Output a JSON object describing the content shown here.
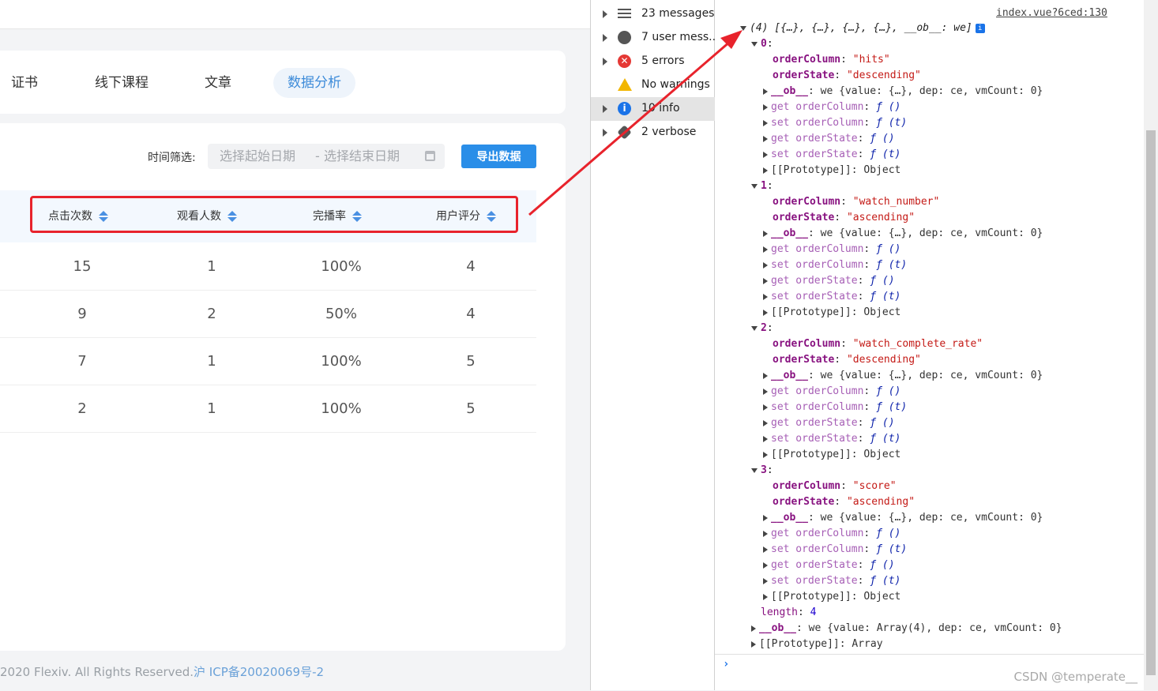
{
  "app": {
    "tabs": [
      {
        "label": "证书",
        "active": false
      },
      {
        "label": "线下课程",
        "active": false
      },
      {
        "label": "文章",
        "active": false
      },
      {
        "label": "数据分析",
        "active": true
      }
    ],
    "filter_label": "时间筛选:",
    "date_start_placeholder": "选择起始日期",
    "date_separator": "-",
    "date_end_placeholder": "选择结束日期",
    "export_label": "导出数据",
    "columns": [
      "点击次数",
      "观看人数",
      "完播率",
      "用户评分"
    ],
    "rows": [
      [
        "15",
        "1",
        "100%",
        "4"
      ],
      [
        "9",
        "2",
        "50%",
        "4"
      ],
      [
        "7",
        "1",
        "100%",
        "5"
      ],
      [
        "2",
        "1",
        "100%",
        "5"
      ]
    ],
    "footer_text": "2020 Flexiv. All Rights Reserved.",
    "footer_icp": "沪 ICP备20020069号-2"
  },
  "console_sidebar": {
    "items": [
      {
        "label": "23 messages",
        "icon": "list-icon"
      },
      {
        "label": "7 user mess...",
        "icon": "user-icon"
      },
      {
        "label": "5 errors",
        "icon": "error-icon"
      },
      {
        "label": "No warnings",
        "icon": "warning-icon"
      },
      {
        "label": "10 info",
        "icon": "info-icon"
      },
      {
        "label": "2 verbose",
        "icon": "verbose-icon"
      }
    ]
  },
  "console": {
    "source_link": "index.vue?6ced:130",
    "summary": "(4) [{…}, {…}, {…}, {…}, __ob__: we]",
    "entries": [
      {
        "index": "0",
        "column": "\"hits\"",
        "state": "\"descending\""
      },
      {
        "index": "1",
        "column": "\"watch_number\"",
        "state": "\"ascending\""
      },
      {
        "index": "2",
        "column": "\"watch_complete_rate\"",
        "state": "\"descending\""
      },
      {
        "index": "3",
        "column": "\"score\"",
        "state": "\"ascending\""
      }
    ],
    "key_order_column": "orderColumn",
    "key_order_state": "orderState",
    "ob_line": "we {value: {…}, dep: ce, vmCount: 0}",
    "proto_line": "[[Prototype]]: Object",
    "length_key": "length",
    "length_value": "4",
    "array_ob_line": "we {value: Array(4), dep: ce, vmCount: 0}",
    "array_proto_line": "[[Prototype]]: Array",
    "prompt": "›",
    "watermark": "CSDN @temperate__"
  },
  "colors": {
    "accent": "#2a8ee8",
    "highlight": "#e8232c",
    "string": "#c41a16",
    "key": "#881280",
    "number": "#1c00cf"
  }
}
